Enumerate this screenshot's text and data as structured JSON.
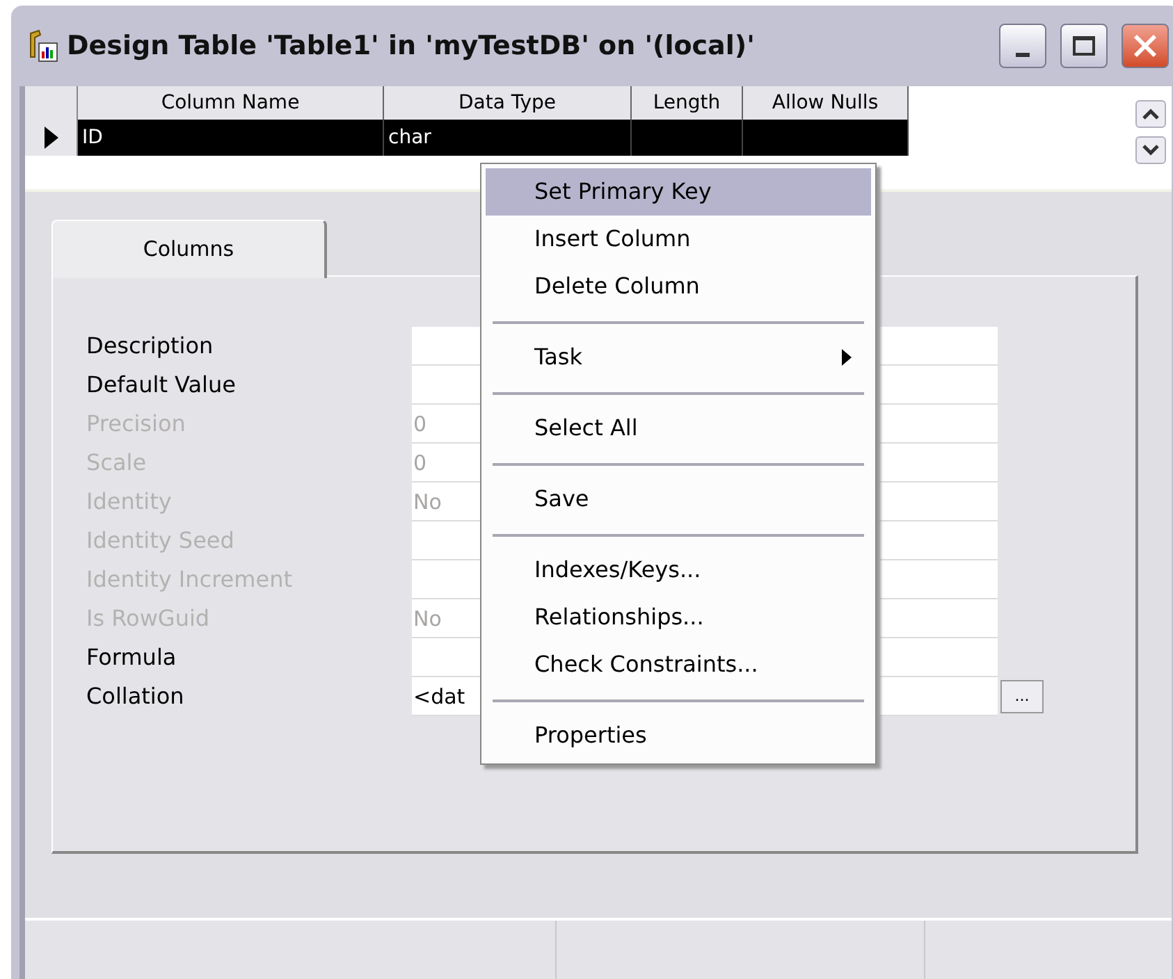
{
  "window": {
    "title": "Design Table 'Table1' in 'myTestDB' on '(local)'"
  },
  "grid": {
    "columns": [
      "Column Name",
      "Data Type",
      "Length",
      "Allow Nulls"
    ],
    "rows": [
      {
        "cells": [
          "ID",
          "char"
        ],
        "selected": true
      }
    ]
  },
  "tabs": [
    {
      "label": "Columns",
      "selected": true
    }
  ],
  "properties": [
    {
      "label": "Description",
      "disabled": false
    },
    {
      "label": "Default Value",
      "disabled": false
    },
    {
      "label": "Precision",
      "value": "0",
      "disabled": true
    },
    {
      "label": "Scale",
      "value": "0",
      "disabled": true
    },
    {
      "label": "Identity",
      "value": "No",
      "disabled": true
    },
    {
      "label": "Identity Seed",
      "disabled": true
    },
    {
      "label": "Identity Increment",
      "disabled": true
    },
    {
      "label": "Is RowGuid",
      "value": "No",
      "disabled": true
    },
    {
      "label": "Formula",
      "disabled": false
    },
    {
      "label": "Collation",
      "value": "<dat",
      "disabled": false,
      "button": "..."
    }
  ],
  "context_menu": [
    {
      "kind": "item",
      "label": "Set Primary Key",
      "selected": true
    },
    {
      "kind": "item",
      "label": "Insert Column",
      "selected": false
    },
    {
      "kind": "item",
      "label": "Delete Column",
      "selected": false
    },
    {
      "kind": "separator"
    },
    {
      "kind": "submenu",
      "label": "Task",
      "selected": false
    },
    {
      "kind": "separator"
    },
    {
      "kind": "item",
      "label": "Select All",
      "selected": false
    },
    {
      "kind": "separator"
    },
    {
      "kind": "item",
      "label": "Save",
      "selected": false
    },
    {
      "kind": "separator"
    },
    {
      "kind": "item",
      "label": "Indexes/Keys...",
      "selected": false
    },
    {
      "kind": "item",
      "label": "Relationships...",
      "selected": false
    },
    {
      "kind": "item",
      "label": "Check Constraints...",
      "selected": false
    },
    {
      "kind": "separator"
    },
    {
      "kind": "item",
      "label": "Properties",
      "selected": false
    }
  ]
}
